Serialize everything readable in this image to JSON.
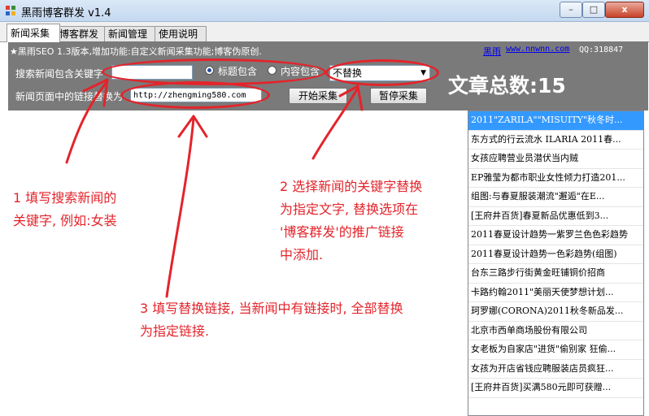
{
  "window": {
    "title": "黑雨博客群发 v1.4",
    "minimize": "–",
    "maximize": "□",
    "close": "x"
  },
  "tabs": [
    {
      "label": "新闻采集",
      "active": true
    },
    {
      "label": "博客群发"
    },
    {
      "label": "新闻管理"
    },
    {
      "label": "使用说明"
    }
  ],
  "header": {
    "info": "★黑雨SEO 1.3版本,增加功能:自定义新闻采集功能;博客伪原创.",
    "brand_link": "黑雨",
    "site_link": "www.nnwnn.com",
    "qq": "QQ:318847"
  },
  "form": {
    "keyword_label": "搜索新闻包含关键字",
    "keyword_value": "",
    "radio_title": "标题包含",
    "radio_content": "内容包含",
    "replace_select": "不替换",
    "link_label": "新闻页面中的链接替换为",
    "link_value": "http://zhengming580.com",
    "start_button": "开始采集",
    "pause_button": "暂停采集",
    "total_label": "文章总数:15"
  },
  "news_list": [
    "2011\"ZARILA\"\"MISUITY\"秋冬时...",
    "东方式的行云流水 ILARIA 2011春...",
    "女孩应聘营业员潜伏当内贼",
    "EP雅莹为都市职业女性倾力打造201...",
    "组图:与春夏服装潮流\"邂逅\"在E...",
    "[王府井百货]春夏新品优惠低到3...",
    "2011春夏设计趋势一紫罗兰色色彩趋势",
    "2011春夏设计趋势一色彩趋势(组图)",
    "台东三路步行街黄金旺铺铜价招商",
    "卡路约翰2011\"美丽天使梦想计划...",
    "珂罗娜(CORONA)2011秋冬新品发...",
    "北京市西单商场股份有限公司",
    "女老板为自家店\"进货\"偷别家 狂偷...",
    "女孩为开店省钱应聘服装店员疯狂...",
    "[王府井百货]买满580元即可获赠..."
  ],
  "annotations": {
    "note1_line1": "1 填写搜索新闻的",
    "note1_line2": "关键字, 例如:女装",
    "note2_line1": "2 选择新闻的关键字替换",
    "note2_line2": "为指定文字, 替换选项在",
    "note2_line3": "'博客群发'的推广链接",
    "note2_line4": "中添加.",
    "note3_line1": "3 填写替换链接, 当新闻中有链接时, 全部替换",
    "note3_line2": "为指定链接."
  },
  "colors": {
    "annotation": "#e3242b",
    "panel": "#7a7a7a",
    "selection": "#3399ff"
  }
}
